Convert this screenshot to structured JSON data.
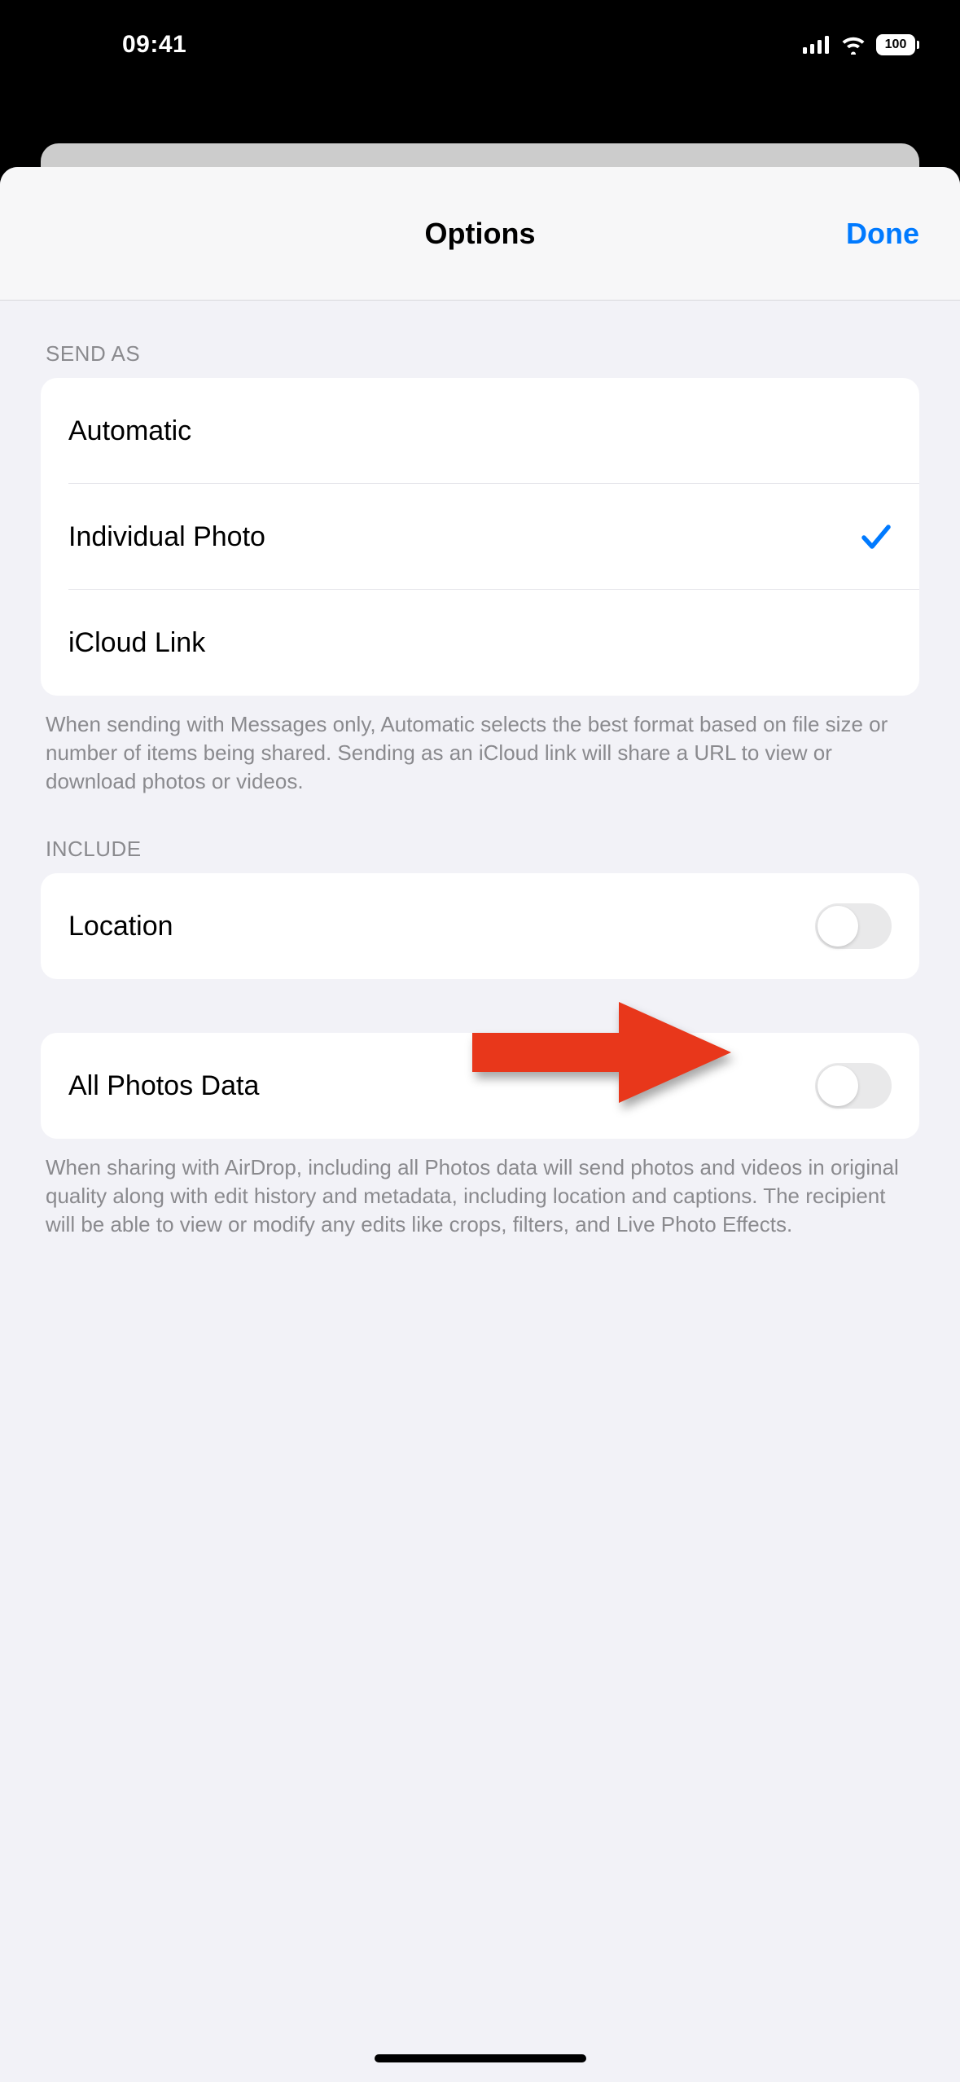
{
  "status": {
    "time": "09:41",
    "battery": "100"
  },
  "header": {
    "title": "Options",
    "done": "Done"
  },
  "sections": {
    "sendAs": {
      "header": "SEND AS",
      "options": [
        {
          "label": "Automatic",
          "selected": false
        },
        {
          "label": "Individual Photo",
          "selected": true
        },
        {
          "label": "iCloud Link",
          "selected": false
        }
      ],
      "footer": "When sending with Messages only, Automatic selects the best format based on file size or number of items being shared. Sending as an iCloud link will share a URL to view or download photos or videos."
    },
    "include": {
      "header": "INCLUDE",
      "rows": {
        "location": {
          "label": "Location",
          "on": false
        },
        "allPhotosData": {
          "label": "All Photos Data",
          "on": false
        }
      },
      "footer": "When sharing with AirDrop, including all Photos data will send photos and videos in original quality along with edit history and metadata, including location and captions. The recipient will be able to view or modify any edits like crops, filters, and Live Photo Effects."
    }
  }
}
